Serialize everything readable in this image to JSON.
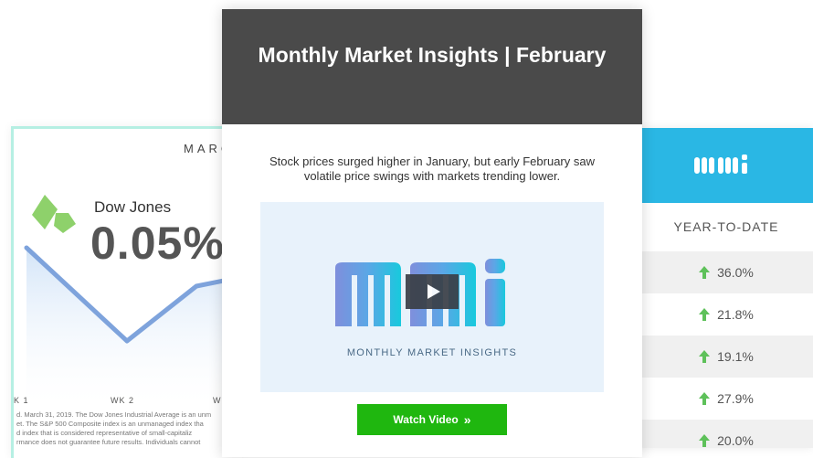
{
  "left_card": {
    "month": "MARC",
    "index_name": "Dow Jones",
    "index_value": "0.05%",
    "week_labels": [
      "K 1",
      "WK 2",
      "W"
    ],
    "disclaimer_lines": [
      "d. March 31, 2019. The Dow Jones Industrial Average is an unm",
      "et. The S&P 500 Composite index is an unmanaged index tha",
      "d index that is considered representative of small-capitaliz",
      "rmance does not guarantee future results. Individuals cannot"
    ]
  },
  "email": {
    "title": "Monthly Market Insights | February",
    "body_lines": [
      "Stock prices surged higher in January, but early February saw",
      "volatile price swings with markets trending lower."
    ],
    "video_caption": "MONTHLY MARKET INSIGHTS",
    "watch_button_label": "Watch Video",
    "watch_button_icon": "»"
  },
  "right_card": {
    "ytd_label": "YEAR-TO-DATE",
    "ytd_values": [
      "36.0%",
      "21.8%",
      "19.1%",
      "27.9%",
      "20.0%"
    ]
  },
  "colors": {
    "header_dark": "#4a4a4a",
    "accent_green": "#1fb70f",
    "accent_blue": "#2ab7e4",
    "logo_green": "#8ed16b"
  }
}
